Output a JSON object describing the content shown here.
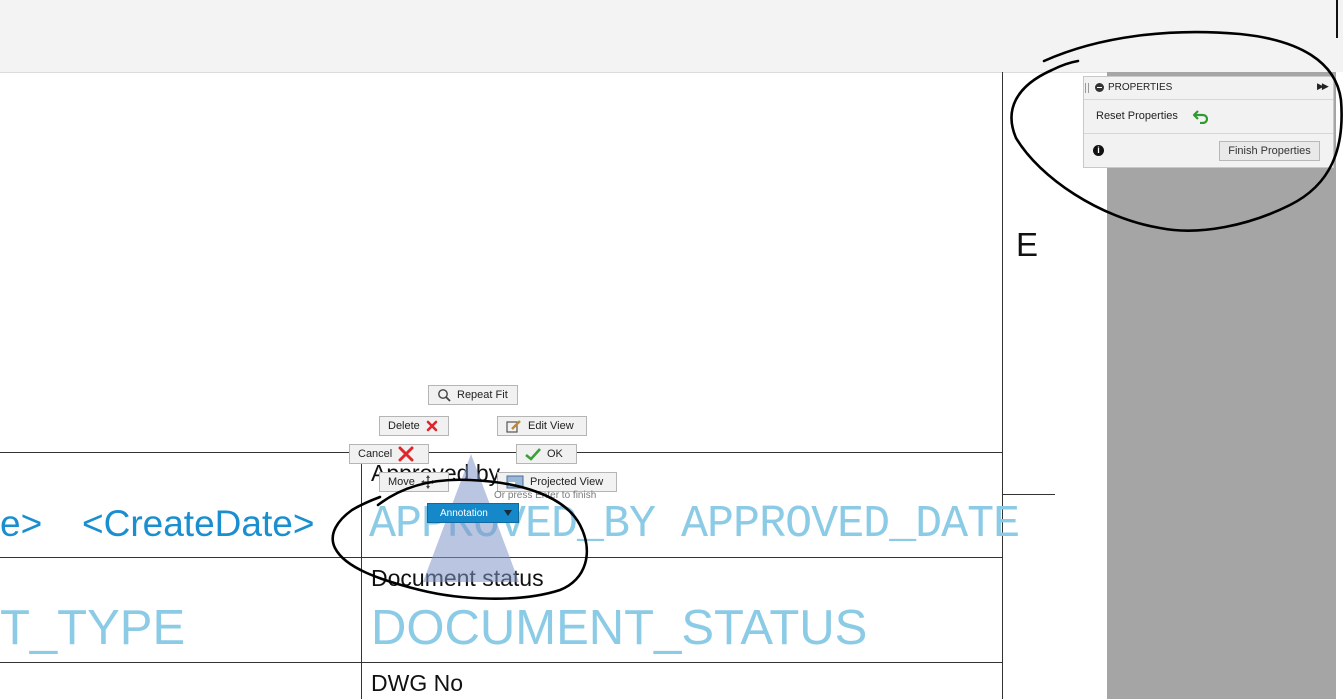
{
  "properties_panel": {
    "title": "PROPERTIES",
    "reset_label": "Reset Properties",
    "finish_label": "Finish Properties"
  },
  "sheet": {
    "zone_letter": "E",
    "approved_by_label": "Approved by",
    "create_date_tail": "e>",
    "create_date_attr": "<CreateDate>",
    "approved_attr": "APPROVED_BY APPROVED_DATE",
    "document_status_label": "Document status",
    "type_attr": "T_TYPE",
    "status_attr": "DOCUMENT_STATUS",
    "dwg_no_label": "DWG No"
  },
  "marking_menu": {
    "repeat_fit": "Repeat Fit",
    "delete": "Delete",
    "edit_view": "Edit View",
    "cancel": "Cancel",
    "ok": "OK",
    "move": "Move",
    "projected_view": "Projected View",
    "annotation": "Annotation",
    "enter_hint": "Or press Enter to finish"
  },
  "colors": {
    "attribute_light_blue": "#8ccbe6",
    "attribute_dark_blue": "#1a8fcf",
    "annotation_button": "#1588c9",
    "sketch_ink": "#000000"
  }
}
